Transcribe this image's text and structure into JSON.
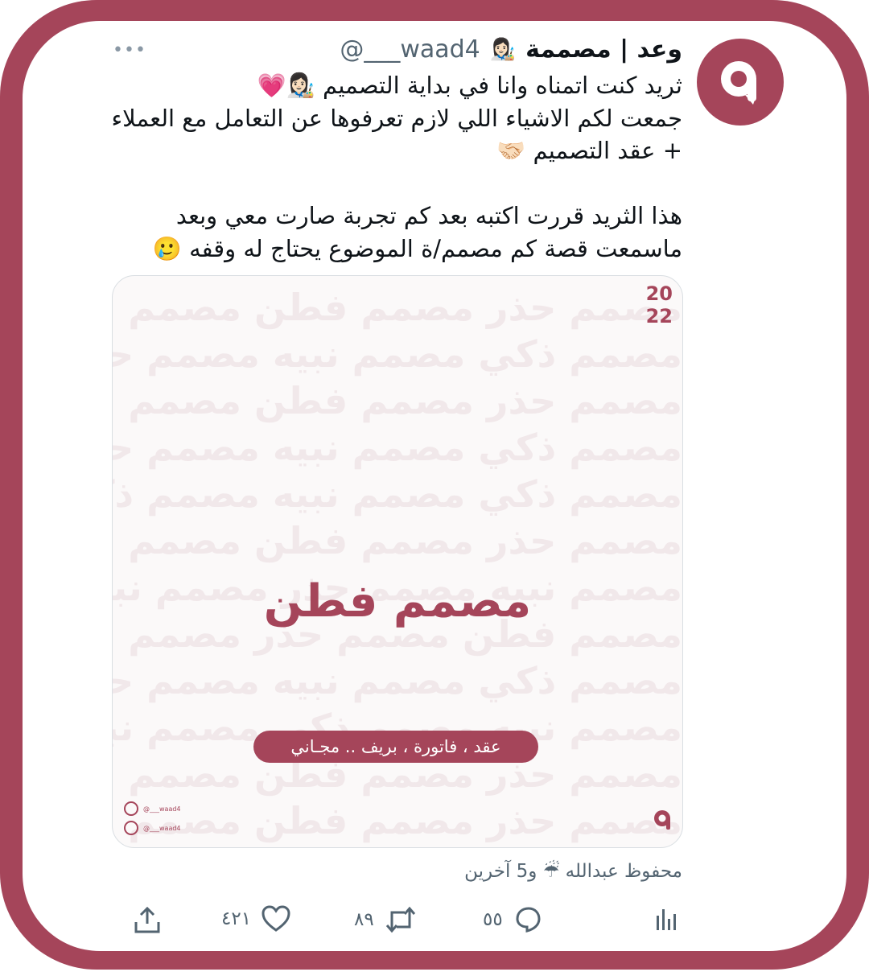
{
  "colors": {
    "brand": "#a5455a",
    "text": "#0f1419",
    "muted": "#536471"
  },
  "tweet": {
    "author_name": "وعد | مصممة",
    "author_emoji": "👩🏻‍🎨",
    "handle": "@___waad4",
    "more_label": "•••",
    "text": "ثريد كنت اتمناه وانا في بداية التصميم 👩🏻‍🎨💗\nجمعت لكم الاشياء اللي لازم تعرفوها عن التعامل مع العملاء\n+ عقد التصميم 🤝🏻\n\nهذا الثريد قررت اكتبه بعد كم تجربة صارت معي وبعد\nماسمعت قصة كم مصمم/ة الموضوع يحتاج له وقفه 🥲",
    "liked_by": "محفوظ عبدالله ☔ و5 آخرين"
  },
  "card": {
    "year_top": "20",
    "year_bottom": "22",
    "pattern_rows": [
      "مصمم حذر مصمم فطن مصمم حذر مصمم فطن مصمم",
      "مصمم ذكي مصمم نبيه مصمم حذر مصمم ذكي مصمم",
      "مصمم حذر مصمم فطن مصمم حذر مصمم فطن مصمم",
      "مصمم ذكي مصمم نبيه مصمم حذر مصمم ذكي مصمم",
      "مصمم ذكي مصمم نبيه مصمم ذكي مصمم نبيه",
      "مصمم حذر مصمم فطن مصمم حذر مصمم فطن مصمم",
      "مصمم نبيه مصمم حذر مصمم نبيه مصمم",
      "مصمم فطن مصمم حذر مصمم فطن مصمم حذر",
      "مصمم ذكي مصمم نبيه مصمم حذر مصمم ذكي مصمم",
      "مصمم نبيه مصمم ذكي مصمم نبيه مصمم",
      "مصمم حذر مصمم فطن مصمم حذر مصمم فطن مصمم",
      "مصمم حذر مصمم فطن مصمم حذر مصمم"
    ],
    "headline": "مصمم فطن",
    "pill_text": "عقد ، فاتورة ، بريف .. مجـاني",
    "instagram_handle": "@___waad4",
    "twitter_handle": "@___waad4"
  },
  "actions": {
    "replies": "٥٥",
    "retweets": "٨٩",
    "likes": "٤٢١"
  }
}
